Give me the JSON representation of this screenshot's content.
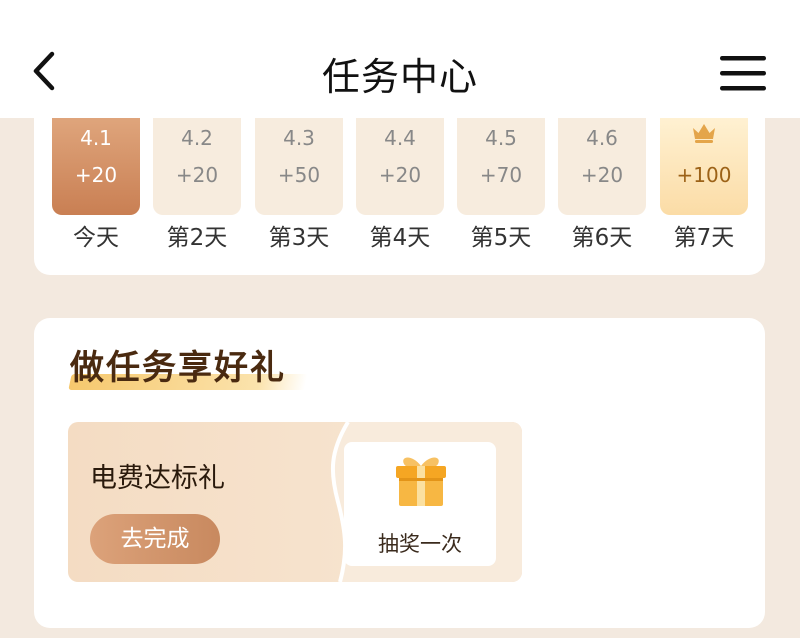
{
  "header": {
    "title": "任务中心",
    "back_icon": "chevron-left-icon",
    "menu_icon": "hamburger-menu-icon"
  },
  "checkin": {
    "days": [
      {
        "date": "4.1",
        "points": "+20",
        "label": "今天",
        "state": "today"
      },
      {
        "date": "4.2",
        "points": "+20",
        "label": "第2天",
        "state": "pending"
      },
      {
        "date": "4.3",
        "points": "+50",
        "label": "第3天",
        "state": "pending"
      },
      {
        "date": "4.4",
        "points": "+20",
        "label": "第4天",
        "state": "pending"
      },
      {
        "date": "4.5",
        "points": "+70",
        "label": "第5天",
        "state": "pending"
      },
      {
        "date": "4.6",
        "points": "+20",
        "label": "第6天",
        "state": "pending"
      },
      {
        "date": "",
        "icon": "crown-icon",
        "points": "+100",
        "label": "第7天",
        "state": "reward"
      }
    ]
  },
  "tasks": {
    "section_title": "做任务享好礼",
    "items": [
      {
        "name": "电费达标礼",
        "action_label": "去完成",
        "reward_label": "抽奖一次",
        "reward_icon": "gift-box-icon"
      }
    ]
  },
  "colors": {
    "page_bg": "#f3e9df",
    "accent": "#c97f53",
    "reward_gold": "#f5a623",
    "title_brown": "#4a2a10"
  }
}
